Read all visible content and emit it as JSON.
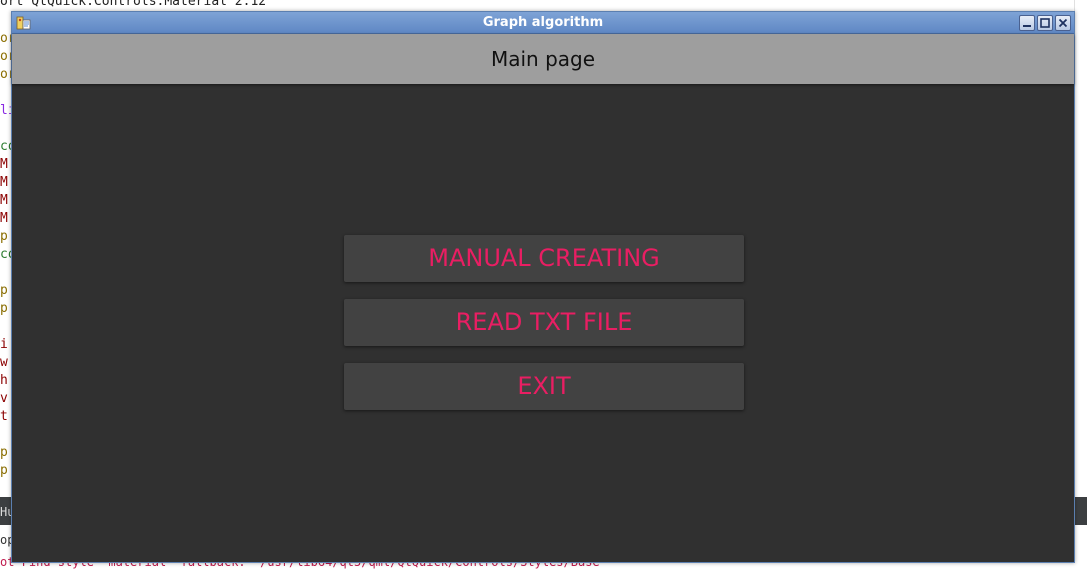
{
  "background_editor": {
    "top_line": "ort QtQuick.Controls.Material 2.12",
    "gutter_chars": [
      "or",
      "or",
      "or",
      "",
      "li",
      "",
      "co",
      "M",
      "M",
      "M",
      "M",
      "p",
      "co",
      "",
      "p",
      "p",
      "",
      "i",
      "w",
      "h",
      "v",
      "t",
      "",
      "p",
      "p"
    ],
    "panel_tab_fragment": "Hu",
    "panel_line_fragment": "op",
    "bottom_line": "ot Find style \"material\" fallback: \"/usr/lib64/qt5/qml/QtQuick/Controls/Styles/Base"
  },
  "window": {
    "title": "Graph algorithm",
    "app_icon": "app-icon",
    "controls": [
      "minimize-icon",
      "maximize-icon",
      "close-icon"
    ]
  },
  "header": {
    "title": "Main page"
  },
  "buttons": {
    "manual_creating": "MANUAL CREATING",
    "read_txt_file": "READ TXT FILE",
    "exit": "EXIT"
  },
  "colors": {
    "accent": "#e91e63",
    "background": "#303030",
    "header": "#9e9e9e",
    "button_bg": "#424242"
  }
}
